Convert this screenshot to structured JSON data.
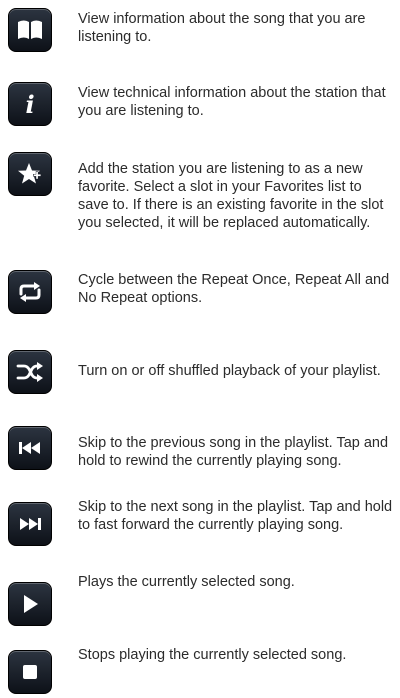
{
  "items": [
    {
      "icon": "book-icon",
      "description": "View information about the song that you are listening to."
    },
    {
      "icon": "info-icon",
      "description": "View technical information about the station that you are listening to."
    },
    {
      "icon": "add-favorite-star-icon",
      "description": "Add the station you are listening to as a new favorite. Select a slot in your Favorites list to save to. If there is an existing favorite in the slot you selected, it will be replaced automatically."
    },
    {
      "icon": "repeat-icon",
      "description": "Cycle between the Repeat Once, Repeat All and No Repeat options."
    },
    {
      "icon": "shuffle-icon",
      "description": "Turn on or off shuffled playback of your playlist."
    },
    {
      "icon": "previous-track-icon",
      "description": "Skip to the previous song in the playlist. Tap and hold to rewind the currently playing song."
    },
    {
      "icon": "next-track-icon",
      "description": "Skip to the next song in the playlist. Tap and hold to fast forward the currently playing song."
    },
    {
      "icon": "play-icon",
      "description": "Plays the currently selected song."
    },
    {
      "icon": "stop-icon",
      "description": "Stops playing the currently selected song."
    }
  ]
}
